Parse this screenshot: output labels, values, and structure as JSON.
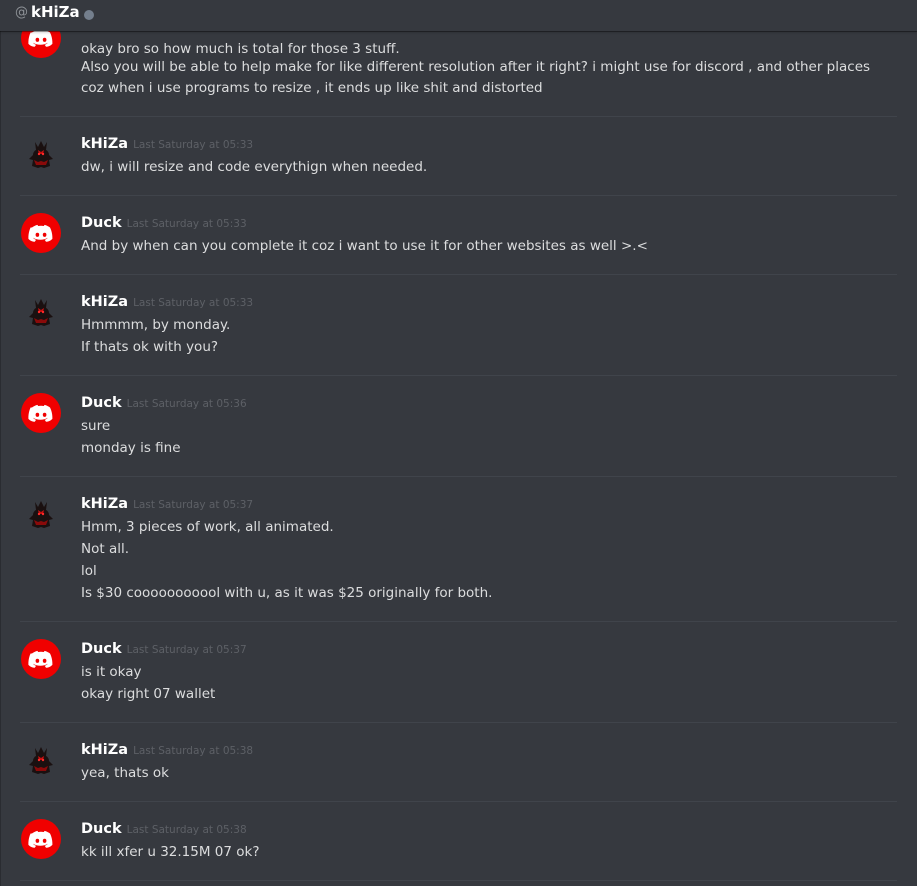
{
  "header": {
    "at_symbol": "@",
    "channel_name": "kHiZa",
    "status_color": "#747f8d"
  },
  "colors": {
    "background": "#36393f",
    "discord_avatar": "#f00000",
    "username": "#ffffff",
    "timestamp": "#5d6066",
    "message_text": "#dcddde"
  },
  "messages": [
    {
      "author": "",
      "avatar": "discord-logo-icon",
      "time": "",
      "lines": [
        "okay bro so how much is total for those 3 stuff.",
        "Also you will be able to help make for like different resolution after it right? i might use for discord , and other places",
        "coz when i use programs to resize , it ends up like shit and distorted"
      ]
    },
    {
      "author": "kHiZa",
      "avatar": "dark-figure-avatar-icon",
      "time": "Last Saturday at 05:33",
      "lines": [
        "dw, i will resize and code everythign when needed."
      ]
    },
    {
      "author": "Duck",
      "avatar": "discord-logo-icon",
      "time": "Last Saturday at 05:33",
      "lines": [
        "And by when can you complete it coz i want to use it for other websites as well >.<"
      ]
    },
    {
      "author": "kHiZa",
      "avatar": "dark-figure-avatar-icon",
      "time": "Last Saturday at 05:33",
      "lines": [
        "Hmmmm, by monday.",
        "If thats ok with you?"
      ]
    },
    {
      "author": "Duck",
      "avatar": "discord-logo-icon",
      "time": "Last Saturday at 05:36",
      "lines": [
        "sure",
        "monday is fine"
      ]
    },
    {
      "author": "kHiZa",
      "avatar": "dark-figure-avatar-icon",
      "time": "Last Saturday at 05:37",
      "lines": [
        "Hmm, 3 pieces of work, all animated.",
        "Not all.",
        "lol",
        "Is $30 cooooooooool with u, as it was $25 originally for both."
      ]
    },
    {
      "author": "Duck",
      "avatar": "discord-logo-icon",
      "time": "Last Saturday at 05:37",
      "lines": [
        "is it okay",
        "okay right 07 wallet"
      ]
    },
    {
      "author": "kHiZa",
      "avatar": "dark-figure-avatar-icon",
      "time": "Last Saturday at 05:38",
      "lines": [
        "yea, thats ok"
      ]
    },
    {
      "author": "Duck",
      "avatar": "discord-logo-icon",
      "time": "Last Saturday at 05:38",
      "lines": [
        "kk ill xfer u 32.15M 07 ok?"
      ]
    }
  ]
}
